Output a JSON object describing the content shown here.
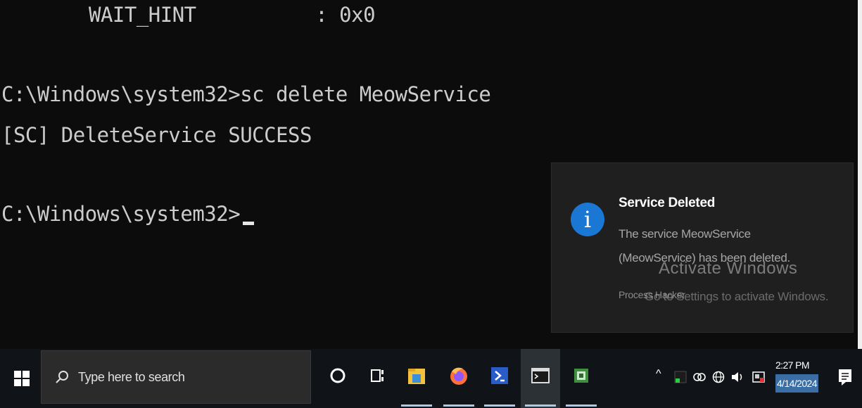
{
  "console": {
    "wait_hint_line": "WAIT_HINT          : 0x0",
    "command_line": "C:\\Windows\\system32>sc delete MeowService",
    "result_line": "[SC] DeleteService SUCCESS",
    "prompt_line": "C:\\Windows\\system32>"
  },
  "toast": {
    "icon": "info-icon",
    "title": "Service Deleted",
    "body": "The service MeowService (MeowService) has been deleted.",
    "app_name": "Process Hacker",
    "watermark_title": "Activate Windows",
    "watermark_subtitle": "Go to Settings to activate Windows."
  },
  "taskbar": {
    "search_placeholder": "Type here to search",
    "pinned_icons": [
      "cortana-icon",
      "task-view-icon",
      "file-explorer-icon",
      "firefox-icon",
      "powershell-icon",
      "command-prompt-icon",
      "process-hacker-icon"
    ],
    "clock": {
      "time": "2:27 PM",
      "date": "4/14/2024"
    }
  },
  "colors": {
    "console_bg": "#0c0c0c",
    "console_text": "#cccccc",
    "toast_bg": "#1f1f1f",
    "accent": "#1a78d4",
    "taskbar_bg": "#101418"
  }
}
